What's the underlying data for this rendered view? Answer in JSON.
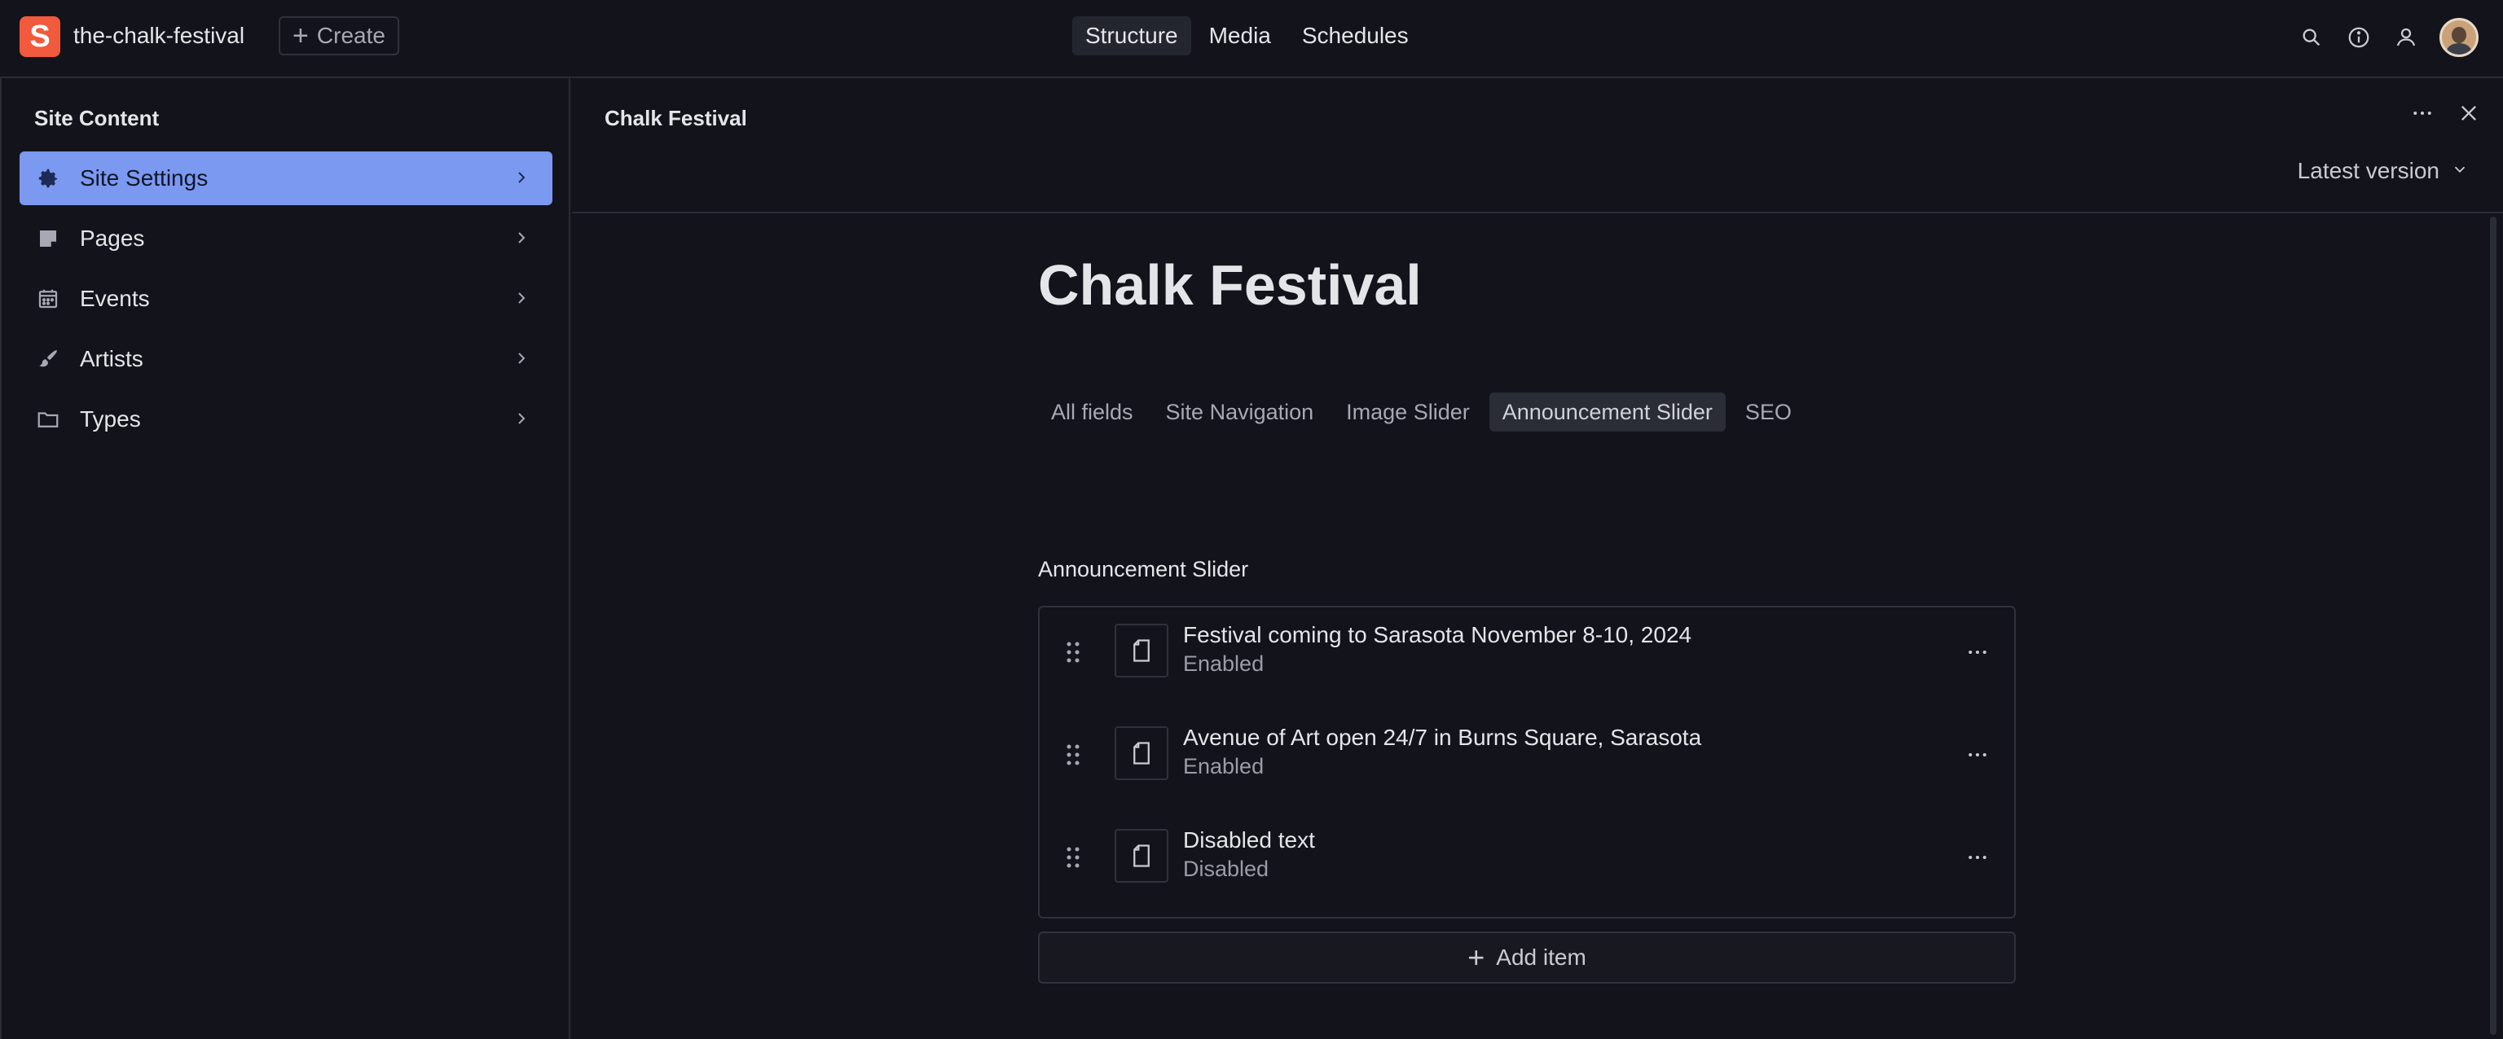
{
  "topbar": {
    "logo_letter": "S",
    "project_name": "the-chalk-festival",
    "create_label": "Create",
    "nav": [
      {
        "label": "Structure",
        "active": true
      },
      {
        "label": "Media",
        "active": false
      },
      {
        "label": "Schedules",
        "active": false
      }
    ],
    "icons": [
      "search-icon",
      "info-icon",
      "users-icon",
      "avatar"
    ]
  },
  "sidebar": {
    "title": "Site Content",
    "items": [
      {
        "label": "Site Settings",
        "icon": "gear-icon",
        "active": true
      },
      {
        "label": "Pages",
        "icon": "sticky-note-icon",
        "active": false
      },
      {
        "label": "Events",
        "icon": "calendar-icon",
        "active": false
      },
      {
        "label": "Artists",
        "icon": "brush-icon",
        "active": false
      },
      {
        "label": "Types",
        "icon": "folder-icon",
        "active": false
      }
    ]
  },
  "panel": {
    "title": "Chalk Festival",
    "version_label": "Latest version"
  },
  "document": {
    "title": "Chalk Festival",
    "tabs": [
      {
        "label": "All fields",
        "active": false
      },
      {
        "label": "Site Navigation",
        "active": false
      },
      {
        "label": "Image Slider",
        "active": false
      },
      {
        "label": "Announcement Slider",
        "active": true
      },
      {
        "label": "SEO",
        "active": false
      }
    ],
    "field_label": "Announcement Slider",
    "items": [
      {
        "title": "Festival coming to Sarasota November 8-10, 2024",
        "status": "Enabled"
      },
      {
        "title": "Avenue of Art open 24/7 in Burns Square, Sarasota",
        "status": "Enabled"
      },
      {
        "title": "Disabled text",
        "status": "Disabled"
      }
    ],
    "add_item_label": "Add item"
  },
  "colors": {
    "background": "#13141b",
    "accent": "#7b99f0",
    "brand": "#f15a3c",
    "border": "#2a2c36"
  }
}
